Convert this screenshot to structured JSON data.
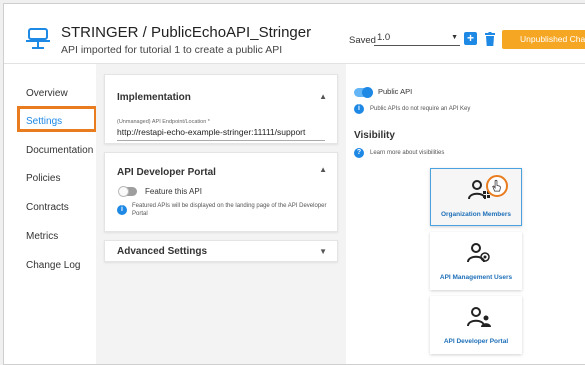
{
  "header": {
    "title": "STRINGER / PublicEchoAPI_Stringer",
    "description": "API imported for tutorial 1 to create a public API",
    "saved_label": "Saved",
    "version": "1.0",
    "publish_label": "Unpublished Changes",
    "accent_color": "#f5a623"
  },
  "sidebar": {
    "items": [
      {
        "label": "Overview"
      },
      {
        "label": "Settings"
      },
      {
        "label": "Documentation"
      },
      {
        "label": "Policies"
      },
      {
        "label": "Contracts"
      },
      {
        "label": "Metrics"
      },
      {
        "label": "Change Log"
      }
    ],
    "active": "Settings"
  },
  "implementation": {
    "title": "Implementation",
    "field_label": "(Unmanaged) API Endpoint/Location *",
    "field_value": "http://restapi-echo-example-stringer:11111/support"
  },
  "developer_portal": {
    "title": "API Developer Portal",
    "toggle_label": "Feature this API",
    "toggle_on": false,
    "info_text": "Featured APIs will be displayed on the landing page of the API Developer Portal"
  },
  "advanced": {
    "title": "Advanced Settings"
  },
  "public_api": {
    "toggle_label": "Public API",
    "toggle_on": true,
    "info_text": "Public APIs do not require an API Key"
  },
  "visibility": {
    "heading": "Visibility",
    "help_text": "Learn more about visibilities",
    "options": [
      {
        "label": "Organization Members",
        "icon": "org-members-icon",
        "selected": true
      },
      {
        "label": "API Management Users",
        "icon": "api-users-icon",
        "selected": false
      },
      {
        "label": "API Developer Portal",
        "icon": "portal-user-icon",
        "selected": false
      }
    ]
  }
}
